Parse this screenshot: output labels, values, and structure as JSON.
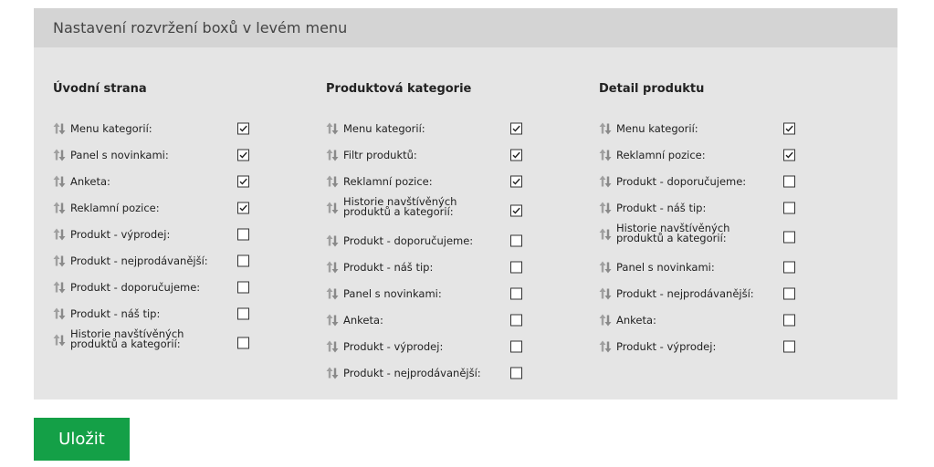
{
  "panel": {
    "title": "Nastavení rozvržení boxů v levém menu"
  },
  "columns": [
    {
      "title": "Úvodní strana",
      "items": [
        {
          "label": "Menu kategorií:",
          "checked": true
        },
        {
          "label": "Panel s novinkami:",
          "checked": true
        },
        {
          "label": "Anketa:",
          "checked": true
        },
        {
          "label": "Reklamní pozice:",
          "checked": true
        },
        {
          "label": "Produkt - výprodej:",
          "checked": false
        },
        {
          "label": "Produkt - nejprodávanější:",
          "checked": false
        },
        {
          "label": "Produkt - doporučujeme:",
          "checked": false
        },
        {
          "label": "Produkt - náš tip:",
          "checked": false
        },
        {
          "label": "Historie navštívěných produktů a kategorií:",
          "checked": false,
          "tall": true
        }
      ]
    },
    {
      "title": "Produktová kategorie",
      "items": [
        {
          "label": "Menu kategorií:",
          "checked": true
        },
        {
          "label": "Filtr produktů:",
          "checked": true
        },
        {
          "label": "Reklamní pozice:",
          "checked": true
        },
        {
          "label": "Historie navštívěných produktů a kategorií:",
          "checked": true,
          "tall": true
        },
        {
          "label": "Produkt - doporučujeme:",
          "checked": false
        },
        {
          "label": "Produkt - náš tip:",
          "checked": false
        },
        {
          "label": "Panel s novinkami:",
          "checked": false
        },
        {
          "label": "Anketa:",
          "checked": false
        },
        {
          "label": "Produkt - výprodej:",
          "checked": false
        },
        {
          "label": "Produkt - nejprodávanější:",
          "checked": false
        }
      ]
    },
    {
      "title": "Detail produktu",
      "items": [
        {
          "label": "Menu kategorií:",
          "checked": true
        },
        {
          "label": "Reklamní pozice:",
          "checked": true
        },
        {
          "label": "Produkt - doporučujeme:",
          "checked": false
        },
        {
          "label": "Produkt - náš tip:",
          "checked": false
        },
        {
          "label": "Historie navštívěných produktů a kategorií:",
          "checked": false,
          "tall": true
        },
        {
          "label": "Panel s novinkami:",
          "checked": false
        },
        {
          "label": "Produkt - nejprodávanější:",
          "checked": false
        },
        {
          "label": "Anketa:",
          "checked": false
        },
        {
          "label": "Produkt - výprodej:",
          "checked": false
        }
      ]
    }
  ],
  "icons": {
    "row_handle": "drag-handle-icon",
    "checkbox_mark": "checkmark-icon"
  },
  "colors": {
    "panel_bg": "#e5e5e5",
    "header_bg": "#d4d4d4",
    "save_button_bg": "#14a047",
    "drag_icon": "#9a9a9a"
  },
  "save_button": {
    "label": "Uložit"
  }
}
